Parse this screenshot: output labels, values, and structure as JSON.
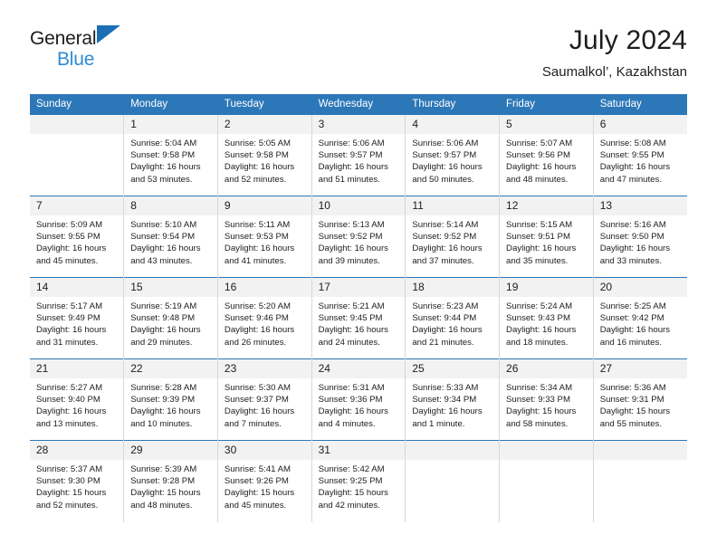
{
  "brand": {
    "name_line1": "General",
    "name_line2": "Blue",
    "color_dark": "#1d1d1d",
    "color_blue": "#2e8bd4"
  },
  "header": {
    "title": "July 2024",
    "subtitle": "Saumalkol’, Kazakhstan"
  },
  "theme": {
    "header_blue": "#2c77b8",
    "daynum_band": "#f2f2f2",
    "cell_border": "#d8d8d8"
  },
  "weekday_headers": [
    "Sunday",
    "Monday",
    "Tuesday",
    "Wednesday",
    "Thursday",
    "Friday",
    "Saturday"
  ],
  "calendar_weeks": [
    [
      {
        "day": "",
        "sunrise": "",
        "sunset": "",
        "daylight1": "",
        "daylight2": ""
      },
      {
        "day": "1",
        "sunrise": "Sunrise: 5:04 AM",
        "sunset": "Sunset: 9:58 PM",
        "daylight1": "Daylight: 16 hours",
        "daylight2": "and 53 minutes."
      },
      {
        "day": "2",
        "sunrise": "Sunrise: 5:05 AM",
        "sunset": "Sunset: 9:58 PM",
        "daylight1": "Daylight: 16 hours",
        "daylight2": "and 52 minutes."
      },
      {
        "day": "3",
        "sunrise": "Sunrise: 5:06 AM",
        "sunset": "Sunset: 9:57 PM",
        "daylight1": "Daylight: 16 hours",
        "daylight2": "and 51 minutes."
      },
      {
        "day": "4",
        "sunrise": "Sunrise: 5:06 AM",
        "sunset": "Sunset: 9:57 PM",
        "daylight1": "Daylight: 16 hours",
        "daylight2": "and 50 minutes."
      },
      {
        "day": "5",
        "sunrise": "Sunrise: 5:07 AM",
        "sunset": "Sunset: 9:56 PM",
        "daylight1": "Daylight: 16 hours",
        "daylight2": "and 48 minutes."
      },
      {
        "day": "6",
        "sunrise": "Sunrise: 5:08 AM",
        "sunset": "Sunset: 9:55 PM",
        "daylight1": "Daylight: 16 hours",
        "daylight2": "and 47 minutes."
      }
    ],
    [
      {
        "day": "7",
        "sunrise": "Sunrise: 5:09 AM",
        "sunset": "Sunset: 9:55 PM",
        "daylight1": "Daylight: 16 hours",
        "daylight2": "and 45 minutes."
      },
      {
        "day": "8",
        "sunrise": "Sunrise: 5:10 AM",
        "sunset": "Sunset: 9:54 PM",
        "daylight1": "Daylight: 16 hours",
        "daylight2": "and 43 minutes."
      },
      {
        "day": "9",
        "sunrise": "Sunrise: 5:11 AM",
        "sunset": "Sunset: 9:53 PM",
        "daylight1": "Daylight: 16 hours",
        "daylight2": "and 41 minutes."
      },
      {
        "day": "10",
        "sunrise": "Sunrise: 5:13 AM",
        "sunset": "Sunset: 9:52 PM",
        "daylight1": "Daylight: 16 hours",
        "daylight2": "and 39 minutes."
      },
      {
        "day": "11",
        "sunrise": "Sunrise: 5:14 AM",
        "sunset": "Sunset: 9:52 PM",
        "daylight1": "Daylight: 16 hours",
        "daylight2": "and 37 minutes."
      },
      {
        "day": "12",
        "sunrise": "Sunrise: 5:15 AM",
        "sunset": "Sunset: 9:51 PM",
        "daylight1": "Daylight: 16 hours",
        "daylight2": "and 35 minutes."
      },
      {
        "day": "13",
        "sunrise": "Sunrise: 5:16 AM",
        "sunset": "Sunset: 9:50 PM",
        "daylight1": "Daylight: 16 hours",
        "daylight2": "and 33 minutes."
      }
    ],
    [
      {
        "day": "14",
        "sunrise": "Sunrise: 5:17 AM",
        "sunset": "Sunset: 9:49 PM",
        "daylight1": "Daylight: 16 hours",
        "daylight2": "and 31 minutes."
      },
      {
        "day": "15",
        "sunrise": "Sunrise: 5:19 AM",
        "sunset": "Sunset: 9:48 PM",
        "daylight1": "Daylight: 16 hours",
        "daylight2": "and 29 minutes."
      },
      {
        "day": "16",
        "sunrise": "Sunrise: 5:20 AM",
        "sunset": "Sunset: 9:46 PM",
        "daylight1": "Daylight: 16 hours",
        "daylight2": "and 26 minutes."
      },
      {
        "day": "17",
        "sunrise": "Sunrise: 5:21 AM",
        "sunset": "Sunset: 9:45 PM",
        "daylight1": "Daylight: 16 hours",
        "daylight2": "and 24 minutes."
      },
      {
        "day": "18",
        "sunrise": "Sunrise: 5:23 AM",
        "sunset": "Sunset: 9:44 PM",
        "daylight1": "Daylight: 16 hours",
        "daylight2": "and 21 minutes."
      },
      {
        "day": "19",
        "sunrise": "Sunrise: 5:24 AM",
        "sunset": "Sunset: 9:43 PM",
        "daylight1": "Daylight: 16 hours",
        "daylight2": "and 18 minutes."
      },
      {
        "day": "20",
        "sunrise": "Sunrise: 5:25 AM",
        "sunset": "Sunset: 9:42 PM",
        "daylight1": "Daylight: 16 hours",
        "daylight2": "and 16 minutes."
      }
    ],
    [
      {
        "day": "21",
        "sunrise": "Sunrise: 5:27 AM",
        "sunset": "Sunset: 9:40 PM",
        "daylight1": "Daylight: 16 hours",
        "daylight2": "and 13 minutes."
      },
      {
        "day": "22",
        "sunrise": "Sunrise: 5:28 AM",
        "sunset": "Sunset: 9:39 PM",
        "daylight1": "Daylight: 16 hours",
        "daylight2": "and 10 minutes."
      },
      {
        "day": "23",
        "sunrise": "Sunrise: 5:30 AM",
        "sunset": "Sunset: 9:37 PM",
        "daylight1": "Daylight: 16 hours",
        "daylight2": "and 7 minutes."
      },
      {
        "day": "24",
        "sunrise": "Sunrise: 5:31 AM",
        "sunset": "Sunset: 9:36 PM",
        "daylight1": "Daylight: 16 hours",
        "daylight2": "and 4 minutes."
      },
      {
        "day": "25",
        "sunrise": "Sunrise: 5:33 AM",
        "sunset": "Sunset: 9:34 PM",
        "daylight1": "Daylight: 16 hours",
        "daylight2": "and 1 minute."
      },
      {
        "day": "26",
        "sunrise": "Sunrise: 5:34 AM",
        "sunset": "Sunset: 9:33 PM",
        "daylight1": "Daylight: 15 hours",
        "daylight2": "and 58 minutes."
      },
      {
        "day": "27",
        "sunrise": "Sunrise: 5:36 AM",
        "sunset": "Sunset: 9:31 PM",
        "daylight1": "Daylight: 15 hours",
        "daylight2": "and 55 minutes."
      }
    ],
    [
      {
        "day": "28",
        "sunrise": "Sunrise: 5:37 AM",
        "sunset": "Sunset: 9:30 PM",
        "daylight1": "Daylight: 15 hours",
        "daylight2": "and 52 minutes."
      },
      {
        "day": "29",
        "sunrise": "Sunrise: 5:39 AM",
        "sunset": "Sunset: 9:28 PM",
        "daylight1": "Daylight: 15 hours",
        "daylight2": "and 48 minutes."
      },
      {
        "day": "30",
        "sunrise": "Sunrise: 5:41 AM",
        "sunset": "Sunset: 9:26 PM",
        "daylight1": "Daylight: 15 hours",
        "daylight2": "and 45 minutes."
      },
      {
        "day": "31",
        "sunrise": "Sunrise: 5:42 AM",
        "sunset": "Sunset: 9:25 PM",
        "daylight1": "Daylight: 15 hours",
        "daylight2": "and 42 minutes."
      },
      {
        "day": "",
        "sunrise": "",
        "sunset": "",
        "daylight1": "",
        "daylight2": ""
      },
      {
        "day": "",
        "sunrise": "",
        "sunset": "",
        "daylight1": "",
        "daylight2": ""
      },
      {
        "day": "",
        "sunrise": "",
        "sunset": "",
        "daylight1": "",
        "daylight2": ""
      }
    ]
  ]
}
